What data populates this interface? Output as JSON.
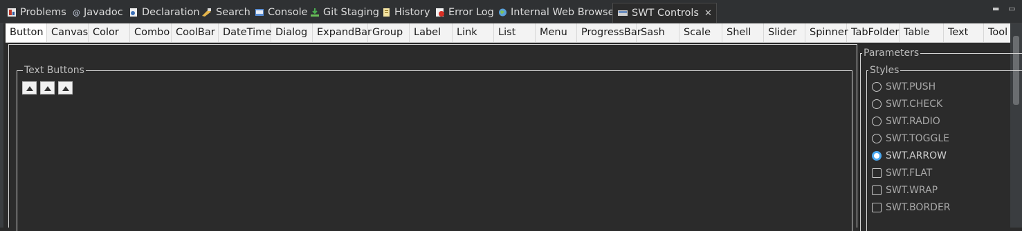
{
  "view_tabs": [
    {
      "label": "Problems",
      "icon": "problems-icon"
    },
    {
      "label": "Javadoc",
      "icon": "javadoc-icon"
    },
    {
      "label": "Declaration",
      "icon": "declaration-icon"
    },
    {
      "label": "Search",
      "icon": "search-icon"
    },
    {
      "label": "Console",
      "icon": "console-icon"
    },
    {
      "label": "Git Staging",
      "icon": "git-staging-icon"
    },
    {
      "label": "History",
      "icon": "history-icon"
    },
    {
      "label": "Error Log",
      "icon": "error-log-icon"
    },
    {
      "label": "Internal Web Browser",
      "icon": "web-browser-icon"
    },
    {
      "label": "SWT Controls",
      "icon": "swt-controls-icon",
      "active": true
    }
  ],
  "control_tabs": [
    "Button",
    "Canvas",
    "Color",
    "Combo",
    "CoolBar",
    "DateTime",
    "Dialog",
    "ExpandBar",
    "Group",
    "Label",
    "Link",
    "List",
    "Menu",
    "ProgressBar",
    "Sash",
    "Scale",
    "Shell",
    "Slider",
    "Spinner",
    "TabFolder",
    "Table",
    "Text",
    "Tool"
  ],
  "active_control_tab": "Button",
  "text_buttons_group": {
    "title": "Text Buttons"
  },
  "parameters_group": {
    "title": "Parameters"
  },
  "styles_group": {
    "title": "Styles",
    "items": [
      {
        "label": "SWT.PUSH",
        "type": "radio",
        "checked": false
      },
      {
        "label": "SWT.CHECK",
        "type": "radio",
        "checked": false
      },
      {
        "label": "SWT.RADIO",
        "type": "radio",
        "checked": false
      },
      {
        "label": "SWT.TOGGLE",
        "type": "radio",
        "checked": false
      },
      {
        "label": "SWT.ARROW",
        "type": "radio",
        "checked": true
      },
      {
        "label": "SWT.FLAT",
        "type": "checkbox",
        "checked": false
      },
      {
        "label": "SWT.WRAP",
        "type": "checkbox",
        "checked": false
      },
      {
        "label": "SWT.BORDER",
        "type": "checkbox",
        "checked": false
      }
    ]
  },
  "colors": {
    "accent": "#4aa8f0",
    "background": "#2b2b2b",
    "tab_bar": "#f3f3f3"
  }
}
